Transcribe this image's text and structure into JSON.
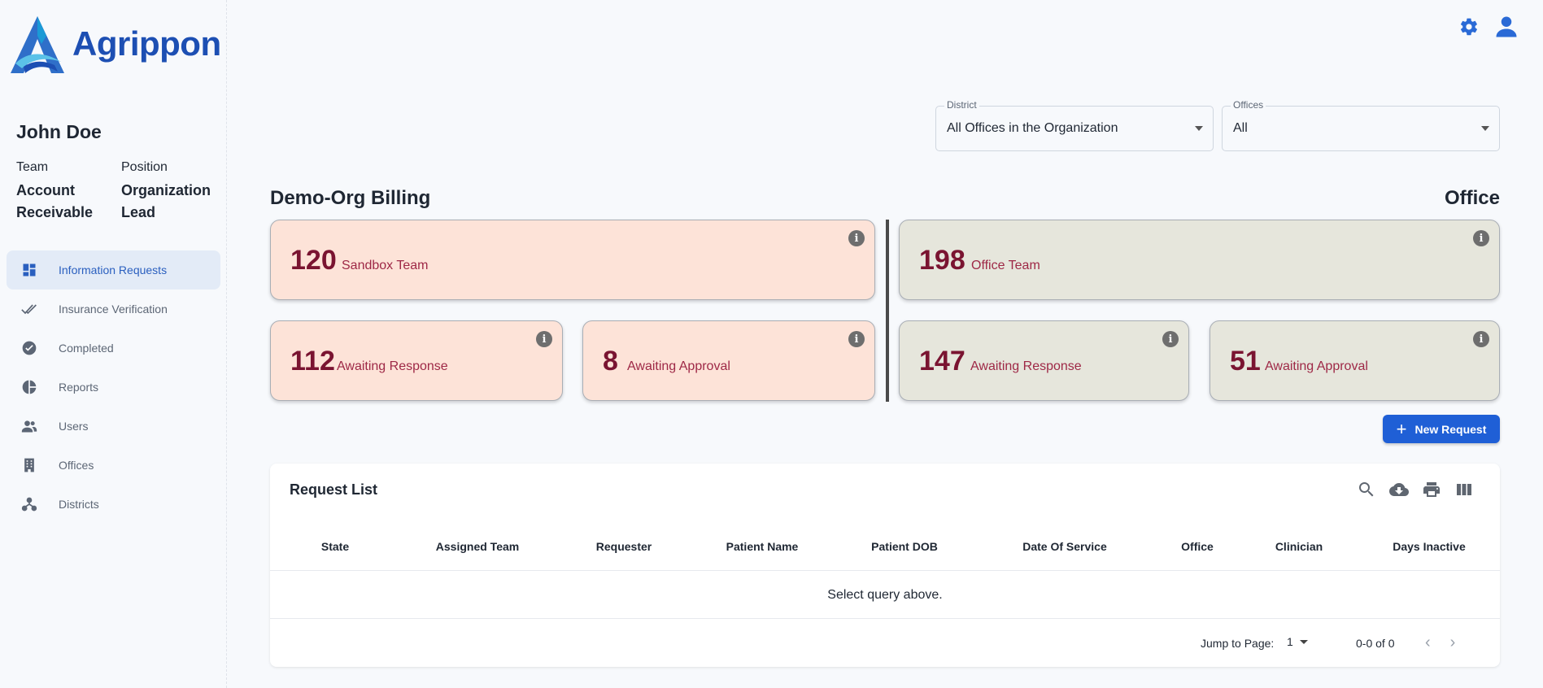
{
  "brand": {
    "name": "Agrippon"
  },
  "user": {
    "name": "John Doe",
    "team_label": "Team",
    "team_value": "Account Receivable",
    "position_label": "Position",
    "position_value": "Organization Lead"
  },
  "nav": [
    {
      "label": "Information Requests",
      "icon": "dashboard-icon",
      "active": true
    },
    {
      "label": "Insurance Verification",
      "icon": "double-check-icon",
      "active": false
    },
    {
      "label": "Completed",
      "icon": "check-circle-icon",
      "active": false
    },
    {
      "label": "Reports",
      "icon": "pie-chart-icon",
      "active": false
    },
    {
      "label": "Users",
      "icon": "users-icon",
      "active": false
    },
    {
      "label": "Offices",
      "icon": "building-icon",
      "active": false
    },
    {
      "label": "Districts",
      "icon": "hierarchy-icon",
      "active": false
    }
  ],
  "filters": {
    "district": {
      "label": "District",
      "value": "All Offices in the Organization"
    },
    "offices": {
      "label": "Offices",
      "value": "All"
    }
  },
  "sections": {
    "left_title": "Demo-Org Billing",
    "right_title": "Office"
  },
  "cards": {
    "sandbox_team": {
      "value": "120",
      "label": "Sandbox Team"
    },
    "sandbox_awaiting_response": {
      "value": "112",
      "label": "Awaiting Response"
    },
    "sandbox_awaiting_approval": {
      "value": "8",
      "label": "Awaiting Approval"
    },
    "office_team": {
      "value": "198",
      "label": "Office Team"
    },
    "office_awaiting_response": {
      "value": "147",
      "label": "Awaiting Response"
    },
    "office_awaiting_approval": {
      "value": "51",
      "label": "Awaiting Approval"
    }
  },
  "new_request_label": "New Request",
  "request_list": {
    "title": "Request List",
    "columns": [
      "State",
      "Assigned Team",
      "Requester",
      "Patient Name",
      "Patient DOB",
      "Date Of Service",
      "Office",
      "Clinician",
      "Days Inactive"
    ],
    "empty_message": "Select query above.",
    "jump_label": "Jump to Page:",
    "page_value": "1",
    "range_text": "0-0 of 0"
  },
  "colors": {
    "accent": "#1f5fd6",
    "sandbox_card_bg": "#fde3d8",
    "office_card_bg": "#e6e6dc",
    "card_value": "#7a1431"
  }
}
